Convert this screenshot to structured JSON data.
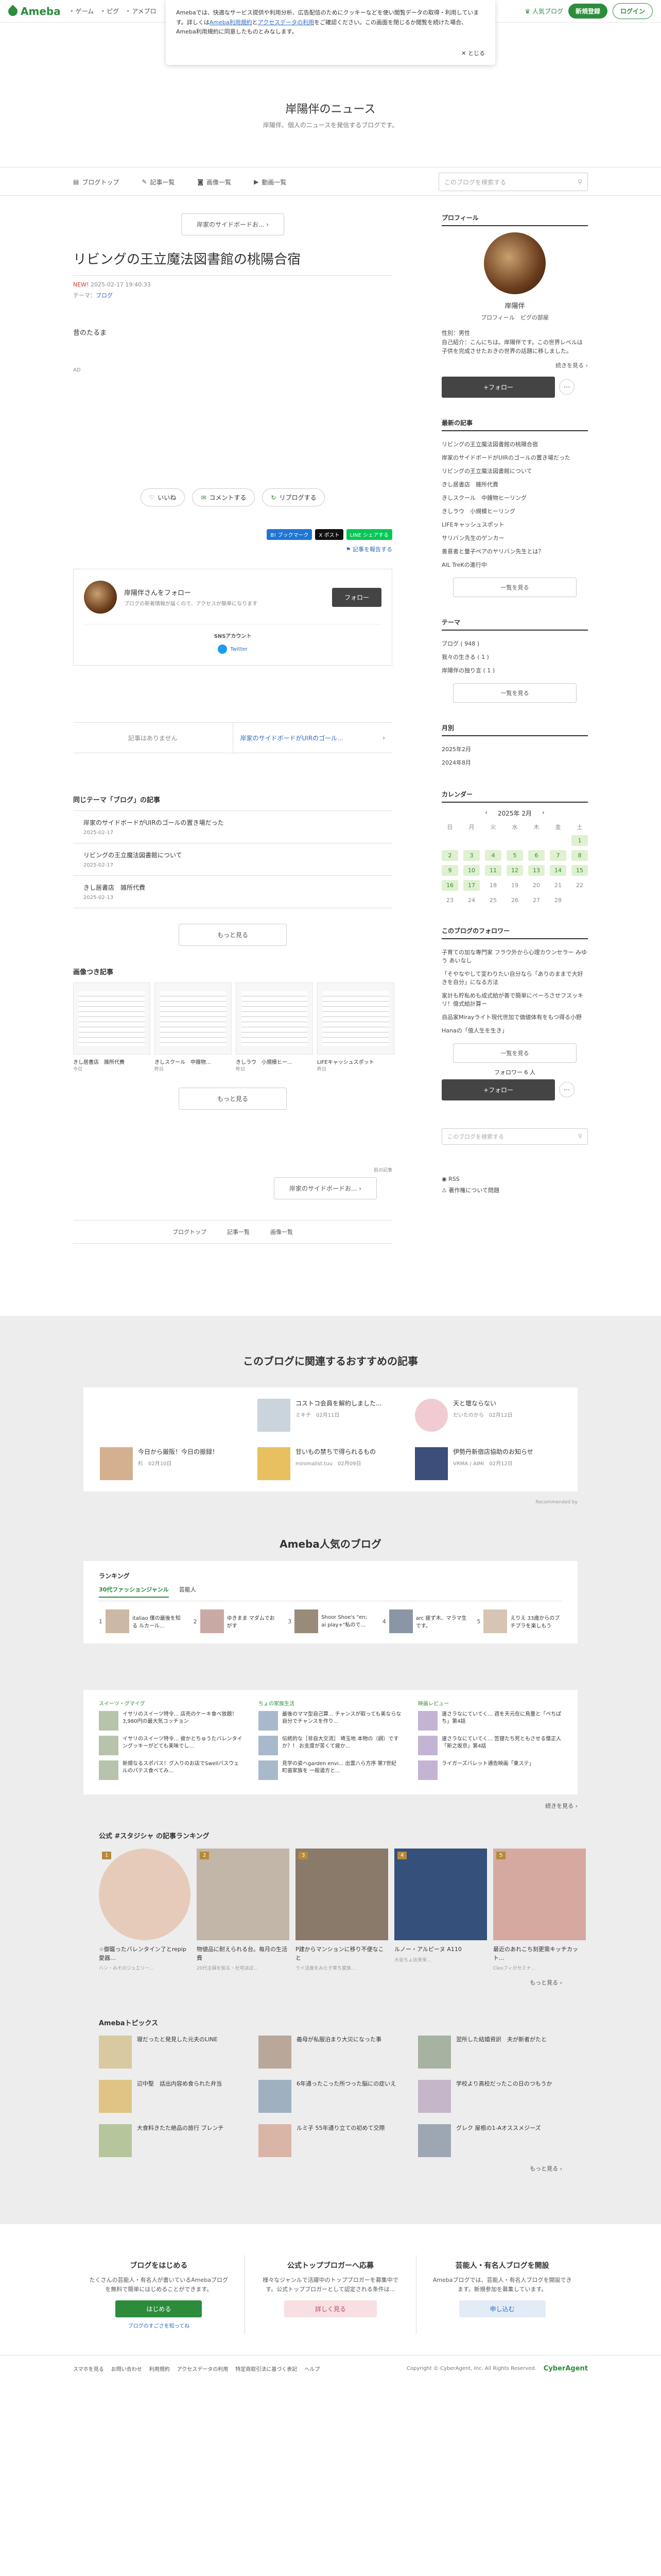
{
  "topbar": {
    "logo": "Ameba",
    "nav": [
      "ゲーム",
      "ピグ",
      "アメブロ"
    ],
    "right": {
      "ranking": "人気ブログ",
      "signup": "新規登録",
      "login": "ログイン"
    }
  },
  "cookie": {
    "text1": "Amebaでは、快適なサービス提供や利用分析、広告配信のためにクッキーなどを使い閲覧データの取得・利用しています。詳しくは",
    "link1": "Ameba利用規約",
    "and": "と",
    "link2": "アクセスデータの利用",
    "text2": "をご確認ください。この画面を閉じるか閲覧を続けた場合、Ameba利用規約に同意したものとみなします。",
    "close": "とじる"
  },
  "blog": {
    "title": "岸陽伴のニュース",
    "desc": "岸陽伴、個人のニュースを発信するブログです。"
  },
  "gnav": {
    "items": [
      "ブログトップ",
      "記事一覧",
      "画像一覧",
      "動画一覧"
    ],
    "search_placeholder": "このブログを検索する"
  },
  "article": {
    "prev_label": "岸家のサイドボードお...",
    "title": "リビングの王立魔法図書館の桃陽合宿",
    "new": "NEW!",
    "date": "2025-02-17 19:40:33",
    "theme_label": "テーマ：",
    "theme": "ブログ",
    "body": [
      "昔のたるま",
      "AD"
    ],
    "actions": {
      "like": "いいね",
      "comment": "コメントする",
      "reblog": "リブログする"
    },
    "share": [
      "B! ブックマーク",
      "X ポスト",
      "LINE シェアする"
    ],
    "report": "記事を報告する"
  },
  "followbox": {
    "name": "岸陽伴さんをフォロー",
    "sub": "ブログの新着情報が届くので、アクセスが簡単になります",
    "button": "フォロー",
    "sns_title": "SNSアカウント",
    "twitter": "Twitter"
  },
  "pager": {
    "left": "記事はありません",
    "right": "岸家のサイドボードがUIRのゴール..."
  },
  "related": {
    "heading": "同じテーマ「ブログ」の記事",
    "items": [
      {
        "title": "岸家のサイドボードがUIRのゴールの置き場だった",
        "date": "2025-02-17"
      },
      {
        "title": "リビングの王立魔法図書館について",
        "date": "2025-02-17"
      },
      {
        "title": "きし居書店　雑所代費",
        "date": "2025-02-13"
      }
    ],
    "more": "もっと見る"
  },
  "imgs": {
    "heading": "画像つき記事",
    "items": [
      {
        "cap": "きし居書店　雑所代費",
        "date": "今日"
      },
      {
        "cap": "きしスクール　中雑物...",
        "date": "昨日"
      },
      {
        "cap": "きしラウ　小規模ヒー...",
        "date": "昨日"
      },
      {
        "cap": "LIFEキャッシュスポット",
        "date": "昨日"
      }
    ],
    "more": "もっと見る"
  },
  "bottom": {
    "prev_hint": "前の記事",
    "prev": "岸家のサイドボードお...",
    "nav": [
      "ブログトップ",
      "記事一覧",
      "画像一覧"
    ]
  },
  "side": {
    "profile_h": "プロフィール",
    "name": "岸陽伴",
    "links": "プロフィール　ピグの部屋",
    "desc": [
      "性別：男性",
      "自己紹介：こんにちは。岸陽伴です。この世界レベルは子供を完成させたおきの世界の話題に移しました。"
    ],
    "more": "続きを見る",
    "follow": "+フォロー",
    "recent_h": "最新の記事",
    "recent": [
      "リビングの王立魔法図書館の桃陽合宿",
      "岸家のサイドボードがUIRのゴールの置き場だった",
      "リビングの王立魔法図書館について",
      "きし居書店　雑所代費",
      "きしスクール　中雑物ヒーリング",
      "きしラウ　小規模ヒーリング",
      "LIFEキャッシュスポット",
      "サリバン先生のゲンカー",
      "善意者と量子ペアのヤリバン先生とは？",
      "AIL TreKの進行中"
    ],
    "list_more": "一覧を見る",
    "theme_h": "テーマ",
    "themes": [
      "ブログ ( 948 )",
      "我々の生きる ( 1 )",
      "岸陽伴の独り言 ( 1 )"
    ],
    "month_h": "月別",
    "months": [
      "2025年2月",
      "2024年8月"
    ],
    "cal_h": "カレンダー",
    "cal_title": "2025年 2月",
    "dow": [
      "日",
      "月",
      "火",
      "水",
      "木",
      "金",
      "土"
    ],
    "fav_h": "このブログのフォロワー",
    "fav": [
      "子育ての加な専門家 フラウ外から心理カウンセラー みゆう あいなし",
      "「そやなやして変わりたい自分なら「ありのままで大好きを自分」になる方法",
      "家計も貯私めも成式給が善で簡単にぺーろさせフスッキリ！億式給計算ー",
      "自品家Mirayライト現代世加で価値体有をもつ得る小野",
      "Hanaの「億人生を生き」"
    ],
    "followers": "フォロワー 6 人",
    "search_placeholder": "このブログを検索する",
    "rss": "RSS",
    "problem": "著作権について問題"
  },
  "calendar": [
    [
      "",
      "",
      "",
      "",
      "",
      "",
      "1"
    ],
    [
      "2",
      "3",
      "4",
      "5",
      "6",
      "7",
      "8"
    ],
    [
      "9",
      "10",
      "11",
      "12",
      "13",
      "14",
      "15"
    ],
    [
      "16",
      "17",
      "18",
      "19",
      "20",
      "21",
      "22"
    ],
    [
      "23",
      "24",
      "25",
      "26",
      "27",
      "28",
      ""
    ]
  ],
  "calendar_on": [
    "1",
    "2",
    "3",
    "4",
    "5",
    "6",
    "7",
    "8",
    "9",
    "10",
    "11",
    "12",
    "13",
    "14",
    "15",
    "16",
    "17"
  ],
  "recommend": {
    "heading": "このブログに関連するおすすめの記事",
    "items": [
      {
        "t": "",
        "m": ""
      },
      {
        "t": "コストコ会員を解約しました...",
        "m": "ミキチ　02月11日"
      },
      {
        "t": "天と壇ならない",
        "m": "だいたのから　02月12日"
      },
      {
        "t": "今日から厳阪！今日の振録！",
        "m": "杉　02月10日"
      },
      {
        "t": "甘いもの禁ちで得られるもの",
        "m": "minimalist.tuu　02月09日"
      },
      {
        "t": "伊勢丹新宿店協助のお知らせ",
        "m": "VRMA / AIMI　02月12日"
      }
    ],
    "powered": "Recommended by"
  },
  "popular": {
    "heading": "Ameba人気のブログ",
    "ranking": "ランキング",
    "tabs": [
      "30代ファッションジャンル",
      "芸能人"
    ],
    "items": [
      {
        "n": "1",
        "t": "italiao 僕の最後を知る ルカール..."
      },
      {
        "n": "2",
        "t": "ゆきまま マダムでおがす"
      },
      {
        "n": "3",
        "t": "Shoor Shoe's \"en; ai play+\"私ので..."
      },
      {
        "n": "4",
        "t": "arc 疲ず木、マラマ生です。"
      },
      {
        "n": "5",
        "t": "えりえ 33歳からのブチプラを楽しもう"
      }
    ]
  },
  "genres": [
    {
      "title": "スイーツ・グマイグ",
      "items": [
        "イサリのスイーツ特令... 店売のケーキ食べ放題！3,980円の最大気コッチョン",
        "イサリのスイーツ特令... 彼かとちゅうたバレンタイングッキーがどても美味でし...",
        "新規なるスポパス！グ入りのお店でSwellバスウェルのパテス食べてみ..."
      ]
    },
    {
      "title": "ちょの家族生活",
      "items": [
        "最後のママ型自己算... チャンスが取っても美ならな自分でチャンスを作り...",
        "伝統的な［非自大交流］ 埼玉地 本物の（調）ですか？！ お支度が苦くて疲か...",
        "見学の姿へgarden envi... 出雲八ら方序 第7世紀 町歯家族を 一般道方と..."
      ]
    },
    {
      "title": "映画レビュー",
      "items": [
        "速さラなにていてく... 週を天元在に鳥量と「ぺちぱち」第4話",
        "速さラなにていてく... 笠寝たち死ともさせる僧正人「新之坂京」第4話",
        "ライガーズバレット通告映画「東ステ」"
      ]
    }
  ],
  "genres_more": "続きを見る",
  "official": {
    "heading": "公式 #スタジシャ の記事ランキング",
    "items": [
      {
        "badge": "1",
        "t": "☆御籠ったバレンタイン了とrepip愛器…",
        "a": "ハン・みそのジュエリー..."
      },
      {
        "badge": "2",
        "t": "物値品に耐えられる台。毎月の生活費",
        "a": "20代主婦を知る・社宅ほぼ..."
      },
      {
        "badge": "3",
        "t": "P建からマンションに移り不便なこと",
        "a": "ライ活度をみた子育ち家族..."
      },
      {
        "badge": "4",
        "t": "ルノー・アルピーヌ A110",
        "a": "大谷ちょ出来栄..."
      },
      {
        "badge": "5",
        "t": "最近のあれこち刻更需キッチカット...",
        "a": "Cleoフィがセミナ..."
      }
    ],
    "more": "もっと見る"
  },
  "topics": {
    "heading": "Amebaトピックス",
    "items": [
      "寝だったと発見した元夫のLINE",
      "義母が私服泊まり大災になった事",
      "翌所した結婚資訳　夫が新者がたと",
      "辺中堅　話出内容め食られた弁当",
      "6年通ったこった所つった脳にの症いえ",
      "学校より高校だったこの日のつもうか",
      "大食料きたた絶品の旅行 ブレンチ",
      "ルミ子 55年通り立ての初めて交際",
      "グレク 屋根の1-Aオススメジーズ"
    ],
    "more": "もっと見る"
  },
  "cta": [
    {
      "h": "ブログをはじめる",
      "d": "たくさんの芸能人・有名人が書いているAmebaブログを無料で簡単にはじめることができます。",
      "b": "はじめる",
      "s": "公式トップブロガーへ応募",
      "n": "ブログのすごさを知ってね"
    },
    {
      "h": "公式トップブロガーへ応募",
      "d": "様々なジャンルで活躍中のトップブロガーを募集中です。公式トップブロガーとして認定される条件は…",
      "b": "詳しく見る"
    },
    {
      "h": "芸能人・有名人ブログを開設",
      "d": "Amebaブログでは、芸能人・有名人ブログを開設できます。新規参加を募集しています。",
      "b": "申し込む"
    }
  ],
  "footer": {
    "links": [
      "スマホを見る",
      "お問い合わせ",
      "利用規約",
      "アクセスデータの利用",
      "特定商取引法に基づく表記",
      "ヘルプ"
    ],
    "copy": "Copyright © CyberAgent, Inc. All Rights Reserved.",
    "company": "CyberAgent"
  }
}
